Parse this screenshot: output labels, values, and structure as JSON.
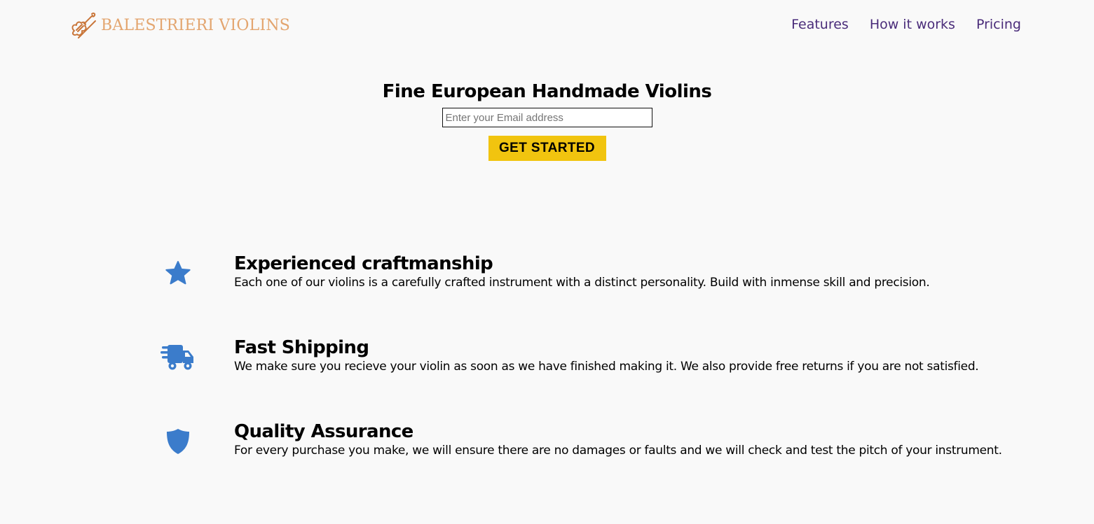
{
  "brand": {
    "name": "BALESTRIERI VIOLINS",
    "color": "#e3a56f"
  },
  "nav": {
    "items": [
      {
        "label": "Features"
      },
      {
        "label": "How it works"
      },
      {
        "label": "Pricing"
      }
    ],
    "color": "#4a2c7a"
  },
  "hero": {
    "title": "Fine European Handmade Violins",
    "email_placeholder": "Enter your Email address",
    "email_value": "",
    "cta_label": "GET STARTED",
    "cta_color": "#f1c40f"
  },
  "features": [
    {
      "icon": "star-icon",
      "title": "Experienced craftmanship",
      "description": "Each one of our violins is a carefully crafted instrument with a distinct personality. Build with inmense skill and precision."
    },
    {
      "icon": "truck-fast-icon",
      "title": "Fast Shipping",
      "description": "We make sure you recieve your violin as soon as we have finished making it. We also provide free returns if you are not satisfied."
    },
    {
      "icon": "shield-icon",
      "title": "Quality Assurance",
      "description": "For every purchase you make, we will ensure there are no damages or faults and we will check and test the pitch of your instrument."
    }
  ],
  "icon_color": "#3b7ccb"
}
